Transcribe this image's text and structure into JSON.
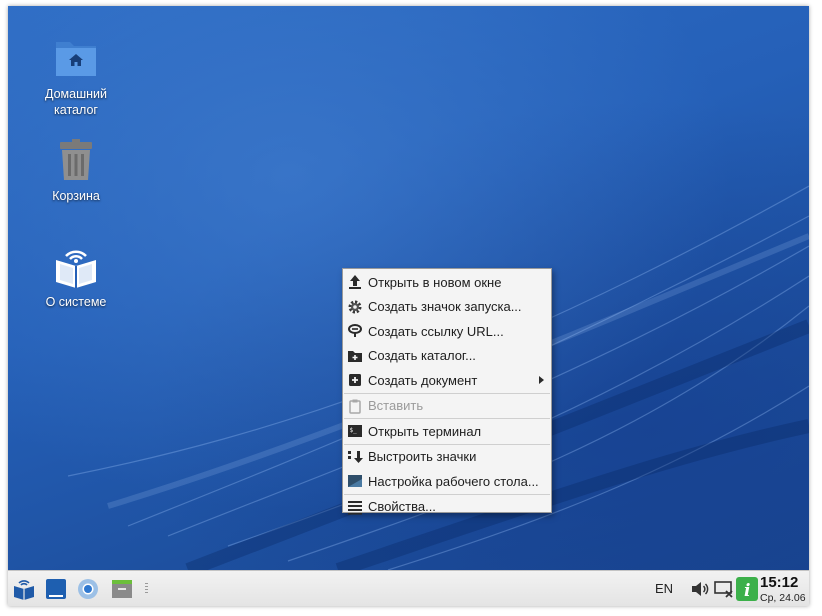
{
  "desktop_icons": [
    {
      "label": "Домашний каталог",
      "icon": "home-folder-icon"
    },
    {
      "label": "Корзина",
      "icon": "trash-icon"
    },
    {
      "label": "О системе",
      "icon": "about-system-icon"
    }
  ],
  "context_menu": {
    "items": [
      {
        "label": "Открыть в новом окне",
        "icon": "upload-arrow-icon",
        "enabled": true
      },
      {
        "label": "Создать значок запуска...",
        "icon": "gear-icon",
        "enabled": true
      },
      {
        "label": "Создать ссылку URL...",
        "icon": "link-icon",
        "enabled": true
      },
      {
        "label": "Создать каталог...",
        "icon": "new-folder-icon",
        "enabled": true
      },
      {
        "label": "Создать документ",
        "icon": "new-document-icon",
        "enabled": true,
        "submenu": true
      },
      {
        "label": "Вставить",
        "icon": "clipboard-icon",
        "enabled": false
      },
      {
        "label": "Открыть терминал",
        "icon": "terminal-icon",
        "enabled": true
      },
      {
        "label": "Выстроить значки",
        "icon": "arrange-icon",
        "enabled": true
      },
      {
        "label": "Настройка рабочего стола...",
        "icon": "desktop-settings-icon",
        "enabled": true
      },
      {
        "label": "Свойства...",
        "icon": "properties-icon",
        "enabled": true
      }
    ]
  },
  "taskbar": {
    "launchers": [
      "start-menu-icon",
      "show-desktop-icon",
      "browser-icon",
      "file-manager-icon"
    ],
    "language": "EN",
    "tray_icons": [
      "volume-icon",
      "network-icon",
      "info-icon"
    ],
    "clock_time": "15:12",
    "clock_date": "Ср, 24.06"
  },
  "colors": {
    "desktop_blue": "#2560b8",
    "menu_bg": "#f4f4f4",
    "info_green": "#3cb04a"
  }
}
